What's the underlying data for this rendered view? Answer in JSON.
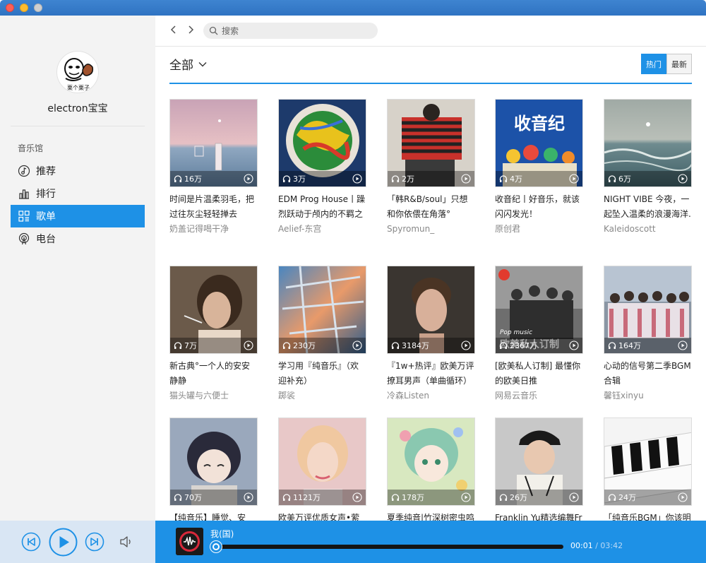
{
  "user": {
    "name": "electron宝宝"
  },
  "sidebar": {
    "section_title": "音乐馆",
    "items": [
      {
        "label": "推荐"
      },
      {
        "label": "排行"
      },
      {
        "label": "歌单"
      },
      {
        "label": "电台"
      }
    ]
  },
  "search": {
    "placeholder": "搜索"
  },
  "filter": {
    "label": "全部"
  },
  "sort": {
    "hot": "热门",
    "new": "最新"
  },
  "playlists": [
    {
      "plays": "16万",
      "title": "时间是片温柔羽毛，把过往灰尘轻轻掸去",
      "author": "奶盖记得喝干净"
    },
    {
      "plays": "3万",
      "title": "EDM Prog House丨躁烈跃动于颅内的不羁之火",
      "author": "Aelief-东宫"
    },
    {
      "plays": "2万",
      "title": "「韩R&B/soul」只想和你依偎在角落°",
      "author": "Spyromun_"
    },
    {
      "plays": "4万",
      "title": "收音纪丨好音乐，就该闪闪发光！",
      "author": "原创君"
    },
    {
      "plays": "6万",
      "title": "NIGHT VIBE 今夜，一起坠入温柔的浪漫海洋.",
      "author": "Kaleidoscott"
    },
    {
      "plays": "7万",
      "title": "新古典°一个人的安安静静",
      "author": "猫头罐与六便士"
    },
    {
      "plays": "230万",
      "title": "学习用『纯音乐』（欢迎补充）",
      "author": "踯裟"
    },
    {
      "plays": "3184万",
      "title": "『1w+热评』欧美万评撩耳男声（单曲循环）",
      "author": "冷森Listen"
    },
    {
      "plays": "2367万",
      "title": "[欧美私人订制] 最懂你的欧美日推",
      "author": "网易云音乐"
    },
    {
      "plays": "164万",
      "title": "心动的信号第二季BGM合辑",
      "author": "馨钰xinyu"
    },
    {
      "plays": "70万",
      "title": "【纯音乐】睡觉、安",
      "author": ""
    },
    {
      "plays": "1121万",
      "title": "欧美万评优质女声•萦绕",
      "author": ""
    },
    {
      "plays": "178万",
      "title": "夏季纯音|竹深树密虫鸣",
      "author": ""
    },
    {
      "plays": "26万",
      "title": "Franklin Yu精选编舞Fr",
      "author": ""
    },
    {
      "plays": "24万",
      "title": "「纯音乐BGM」你该明",
      "author": ""
    }
  ],
  "cover_texts": {
    "c4": "收音纪",
    "c9_top": "Pop music",
    "c9_bottom": "欧美私人订制",
    "avatar": "栗个栗子"
  },
  "player": {
    "song": "我(国)",
    "current": "00:01",
    "total": "/ 03:42",
    "progress": 0.003
  },
  "colors": {
    "accent": "#1e91e6",
    "sidebar_bg": "#f3f3f3"
  }
}
